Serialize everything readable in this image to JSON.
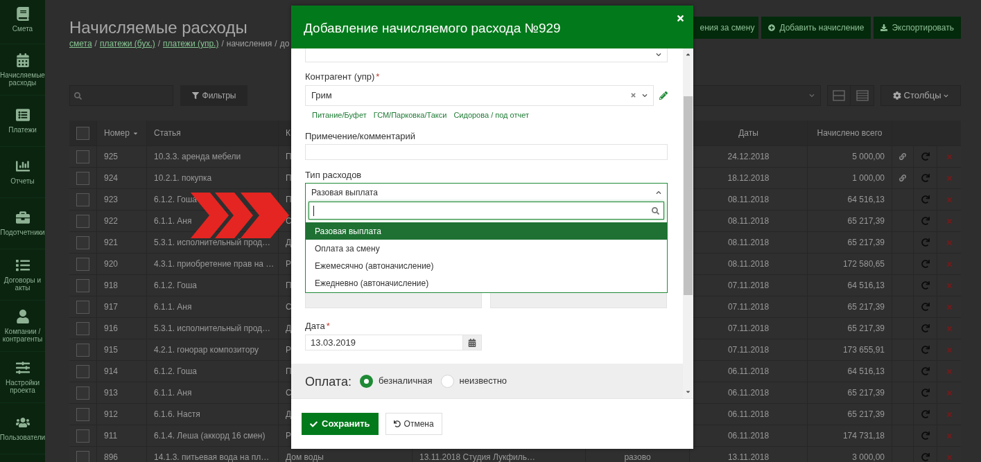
{
  "sidebar": {
    "items": [
      {
        "label": "Смета"
      },
      {
        "label": "Начисляемые расходы"
      },
      {
        "label": "Платежи"
      },
      {
        "label": "Отчеты"
      },
      {
        "label": "Подотчетники"
      },
      {
        "label": "Договоры и акты"
      },
      {
        "label": "Компании / контрагенты"
      },
      {
        "label": "Настройки проекта"
      },
      {
        "label": "Пользователи"
      }
    ]
  },
  "page": {
    "title": "Начисляемые расходы",
    "breadcrumb_separator": "/",
    "breadcrumb": [
      {
        "text": "смета",
        "link": true
      },
      {
        "text": "платежи (бух.)",
        "link": true
      },
      {
        "text": "платежи (упр.)",
        "link": true
      },
      {
        "text": "начисления",
        "link": false
      },
      {
        "text": "до",
        "link": false
      }
    ],
    "actions": [
      {
        "label": "ения за смену",
        "kind": "plain"
      },
      {
        "label": "Добавить начисление",
        "kind": "add"
      },
      {
        "label": "Экспортировать",
        "kind": "export"
      }
    ]
  },
  "toolbar": {
    "filters_button": "Фильтры",
    "columns_button": "Столбцы"
  },
  "table": {
    "all_checked": false,
    "columns": [
      {
        "label": "Номер",
        "sorted": true
      },
      {
        "label": "Статья"
      },
      {
        "label": "К"
      },
      {
        "label": "Даты"
      },
      {
        "label": "Начислено всего"
      }
    ],
    "rows": [
      {
        "checked": false,
        "number": "925",
        "article": "10.3.3. аренда мебели",
        "column_3": "П",
        "date": "24.12.2018",
        "total": "5 000,00",
        "linked": true
      },
      {
        "checked": false,
        "number": "924",
        "article": "10.2.1. покупка",
        "column_3": "П",
        "date": "18.12.2018",
        "total": "1 000,00",
        "linked": true
      },
      {
        "checked": false,
        "number": "923",
        "article": "6.1.2. Гоша",
        "column_3": "П",
        "date": "08.11.2018",
        "total": "64 516,13",
        "linked": false
      },
      {
        "checked": false,
        "number": "922",
        "article": "6.1.1. Аня",
        "column_3": "С",
        "date": "08.11.2018",
        "total": "65 217,39",
        "linked": false
      },
      {
        "checked": false,
        "number": "921",
        "article": "5.3.1. исполнительный прод…",
        "column_3": "Д",
        "date": "08.11.2018",
        "total": "65 217,39",
        "linked": false
      },
      {
        "checked": false,
        "number": "920",
        "article": "4.3.1. приобретение прав на …",
        "column_3": "Р",
        "date": "08.11.2018",
        "total": "172 580,65",
        "linked": false
      },
      {
        "checked": false,
        "number": "918",
        "article": "6.1.2. Гоша",
        "column_3": "П",
        "date": "07.11.2018",
        "total": "64 516,13",
        "linked": false
      },
      {
        "checked": false,
        "number": "917",
        "article": "6.1.1. Аня",
        "column_3": "С",
        "date": "07.11.2018",
        "total": "65 217,39",
        "linked": false
      },
      {
        "checked": false,
        "number": "916",
        "article": "5.3.1. исполнительный прод…",
        "column_3": "Д",
        "date": "07.11.2018",
        "total": "65 217,39",
        "linked": false
      },
      {
        "checked": false,
        "number": "915",
        "article": "4.2.1. гонорар композитору",
        "column_3": "Р",
        "date": "07.11.2018",
        "total": "173 655,91",
        "linked": false
      },
      {
        "checked": false,
        "number": "914",
        "article": "6.1.2. Гоша",
        "column_3": "П",
        "date": "06.11.2018",
        "total": "64 516,13",
        "linked": false
      },
      {
        "checked": false,
        "number": "913",
        "article": "6.1.1. Аня",
        "column_3": "С",
        "date": "06.11.2018",
        "total": "65 217,39",
        "linked": false
      },
      {
        "checked": false,
        "number": "912",
        "article": "6.1.6. Настя",
        "column_3": "Д",
        "date": "06.11.2018",
        "total": "65 217,39",
        "linked": false
      },
      {
        "checked": false,
        "number": "911",
        "article": "6.1.4. Леша (аккорд 16 смен)",
        "column_3": "Р",
        "date": "06.11.2018",
        "total": "174 731,18",
        "linked": false
      },
      {
        "checked": false,
        "number": "896",
        "article": "14.1.3. питьевая вода на пл…",
        "column_3": "Дом воды",
        "column_4": "13.11.2018 Студия Лукфиль…",
        "column_5": "разово",
        "date": "13.11.2018",
        "total": "3 000,00",
        "linked": false
      }
    ]
  },
  "modal": {
    "title": "Добавление начисляемого расхода №929",
    "counterparty": {
      "label": "Контрагент (упр)",
      "required_mark": "*",
      "value": "Грим",
      "suggestions": [
        "Питание/Буфет",
        "ГСМ/Парковка/Такси",
        "Сидорова / под отчет"
      ]
    },
    "comment": {
      "label": "Примечение/комментарий"
    },
    "expense_type": {
      "label": "Тип расходов",
      "value": "Разовая выплата",
      "expanded": true,
      "options": [
        {
          "label": "Разовая выплата",
          "selected": true
        },
        {
          "label": "Оплата за смену",
          "selected": false
        },
        {
          "label": "Ежемесячно (автоначисление)",
          "selected": false
        },
        {
          "label": "Ежедневно (автоначисление)",
          "selected": false
        }
      ]
    },
    "date": {
      "label": "Дата",
      "required_mark": "*",
      "value": "13.03.2019"
    },
    "payment": {
      "label": "Оплата:",
      "options": [
        {
          "label": "безналичная",
          "selected": true
        },
        {
          "label": "неизвестно",
          "selected": false
        }
      ]
    },
    "buttons": [
      {
        "label": "Сохранить",
        "kind": "primary"
      },
      {
        "label": "Отмена",
        "kind": "cancel"
      }
    ]
  }
}
